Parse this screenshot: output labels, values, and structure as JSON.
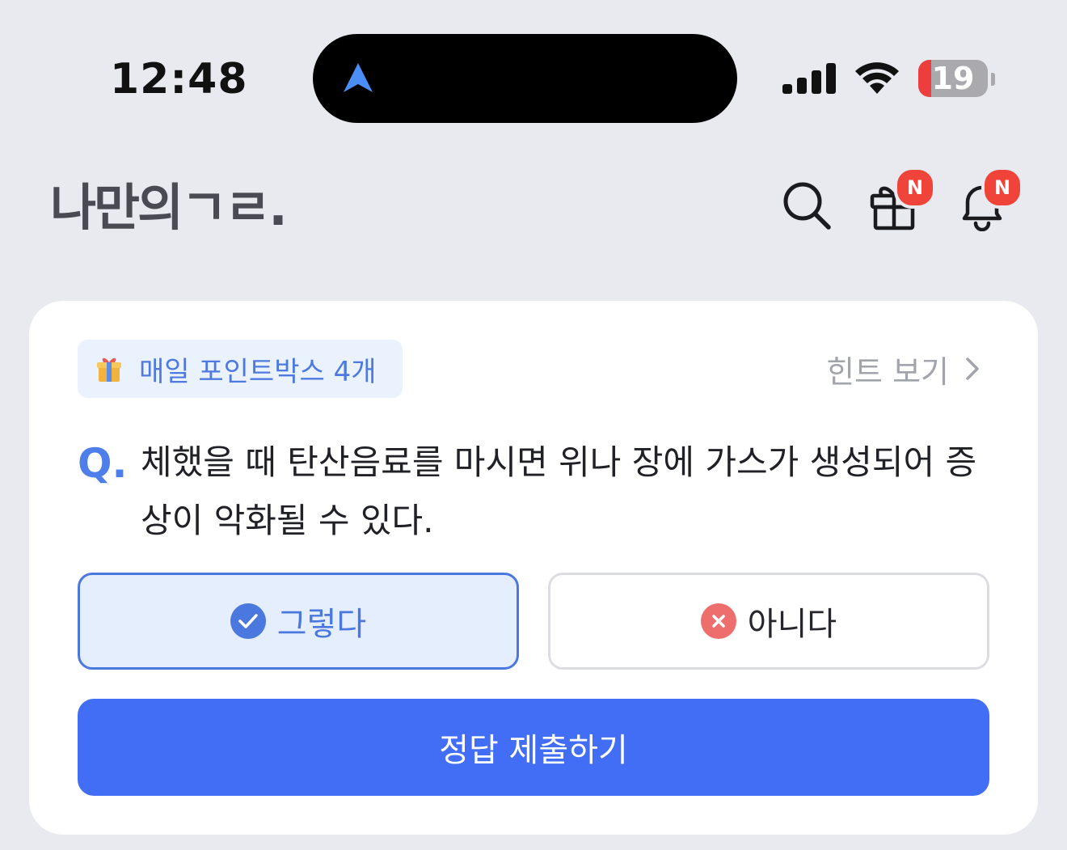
{
  "status_bar": {
    "time": "12:48",
    "battery_level": "19",
    "battery_fraction": 0.19
  },
  "header": {
    "logo_text": "나만의ㄱㄹ.",
    "gift_badge": "N",
    "bell_badge": "N"
  },
  "quiz": {
    "points_label": "매일 포인트박스 4개",
    "hint_label": "힌트 보기",
    "q_mark": "Q.",
    "question": "체했을 때 탄산음료를 마시면 위나 장에 가스가 생성되어 증상이 악화될 수 있다.",
    "answer_yes": "그렇다",
    "answer_no": "아니다",
    "selected_answer": "그렇다",
    "submit_label": "정답 제출하기"
  },
  "colors": {
    "background": "#E9EAF0",
    "accent": "#426EF5",
    "badge": "#F0443A",
    "selected_border": "#4B78DE",
    "wrong_icon": "#EE6E6E"
  },
  "icons": [
    "location-arrow-icon",
    "cellular-signal-icon",
    "wifi-icon",
    "battery-icon",
    "search-icon",
    "gift-icon",
    "bell-icon",
    "gift-box-emoji",
    "chevron-right-icon",
    "check-circle-icon",
    "x-circle-icon"
  ]
}
